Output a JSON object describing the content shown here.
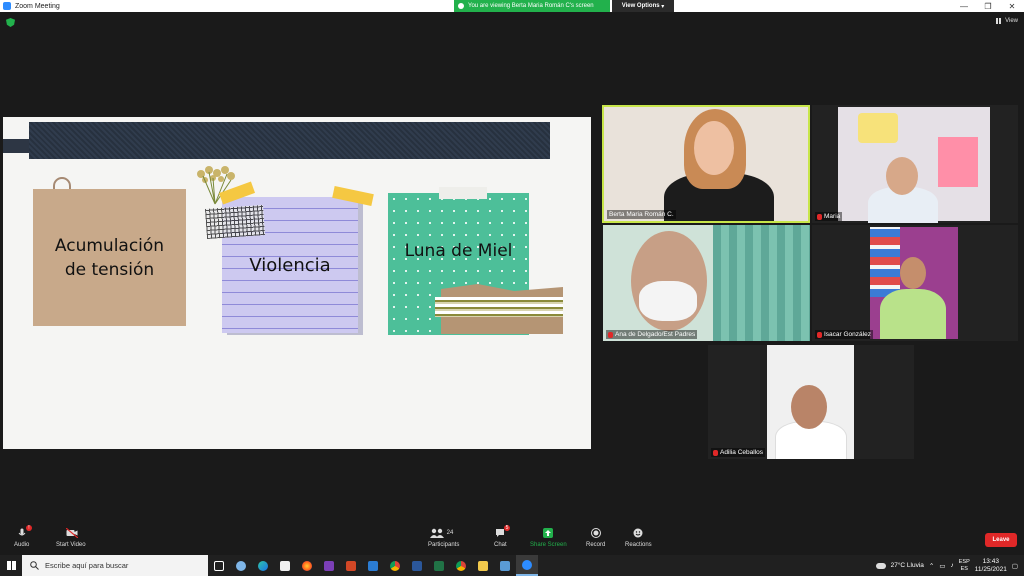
{
  "window": {
    "title": "Zoom Meeting"
  },
  "share_banner": {
    "text": "You are viewing Berta Maria Román C's screen",
    "view_options": "View Options"
  },
  "topbar": {
    "view_label": "View"
  },
  "slide": {
    "notes": [
      {
        "text": "Acumulación de tensión"
      },
      {
        "text": "Violencia"
      },
      {
        "text": "Luna de Miel"
      }
    ]
  },
  "participants_video": [
    {
      "name": "Berta Maria Román C.",
      "muted": false,
      "active_speaker": true
    },
    {
      "name": "Maria",
      "muted": true
    },
    {
      "name": "Ana de Delgado/Est Padres",
      "muted": true
    },
    {
      "name": "Isacar González",
      "muted": true
    },
    {
      "name": "Adilia Ceballos",
      "muted": true
    }
  ],
  "toolbar": {
    "audio": "Audio",
    "start_video": "Start Video",
    "participants": "Participants",
    "participants_count": "24",
    "chat": "Chat",
    "chat_badge": "5",
    "share_screen": "Share Screen",
    "record": "Record",
    "reactions": "Reactions",
    "leave": "Leave"
  },
  "taskbar": {
    "search_placeholder": "Escribe aquí para buscar",
    "weather": "27°C Lluvia",
    "lang_top": "ESP",
    "lang_bottom": "ES",
    "time": "13:43",
    "date": "11/25/2021"
  },
  "colors": {
    "zoom_blue": "#2d8cff",
    "share_green": "#22b14c",
    "leave_red": "#e02828",
    "speaker_border": "#c8e64a"
  }
}
